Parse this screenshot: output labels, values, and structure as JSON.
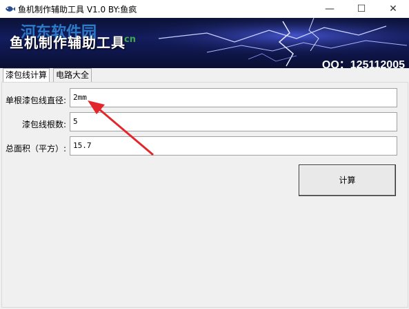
{
  "window": {
    "title": "鱼机制作辅助工具 V1.0  BY:鱼疯",
    "controls": {
      "minimize": "—",
      "maximize": "☐",
      "close": "✕"
    }
  },
  "banner": {
    "title": "鱼机制作辅助工具",
    "qq": "QQ：125112005",
    "watermark_main": "河东软件园",
    "watermark_sub": "cn"
  },
  "tabs": [
    {
      "label": "漆包线计算",
      "active": true
    },
    {
      "label": "电路大全",
      "active": false
    }
  ],
  "form": {
    "diameter_label": "单根漆包线直径:",
    "diameter_value": "2mm",
    "count_label": "漆包线根数:",
    "count_value": "5",
    "area_label": "总面积（平方）:",
    "area_value": "15.7",
    "calc_button": "计算"
  },
  "colors": {
    "annotation_arrow": "#e3262b",
    "banner_bg": "#131c5e"
  }
}
